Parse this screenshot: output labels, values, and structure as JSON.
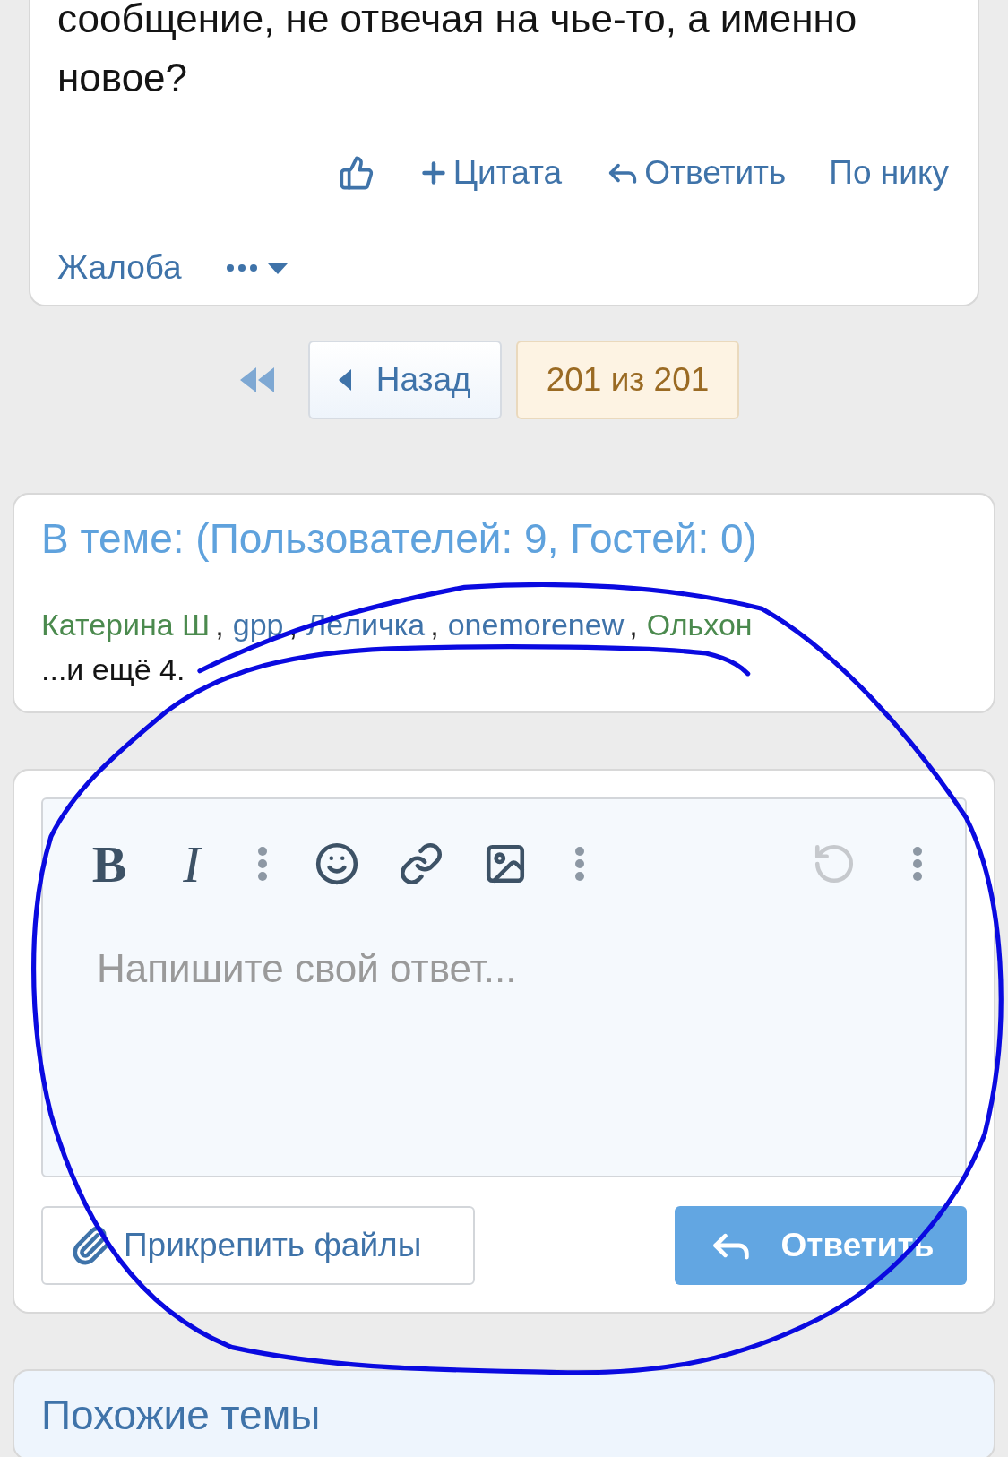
{
  "post": {
    "text": "сообщение, не отвечая на чье-то, а именно новое?",
    "actions_row_1": [
      {
        "kind": "like"
      },
      {
        "kind": "quote",
        "label": "Цитата"
      },
      {
        "kind": "reply",
        "label": "Ответить"
      },
      {
        "kind": "plain",
        "label": "По нику"
      }
    ],
    "actions_row_2": [
      {
        "kind": "plain",
        "label": "Жалоба"
      },
      {
        "kind": "more"
      }
    ]
  },
  "pagination": {
    "previous": "Назад",
    "current": "201 из 201"
  },
  "online": {
    "title": "В теме: (Пользователей: 9, Гостей: 0)",
    "separator": ",",
    "users": [
      {
        "name": "Катерина Ш",
        "color": "#4b8a4e"
      },
      {
        "name": "gpp",
        "color": "#3f73a9"
      },
      {
        "name": "Лёличка",
        "color": "#3f73a9"
      },
      {
        "name": "onemorenew",
        "color": "#3f73a9"
      },
      {
        "name": "Ольхон",
        "color": "#4b8a4e"
      }
    ],
    "more": "...и ещё 4."
  },
  "editor": {
    "toolbar_left": [
      {
        "kind": "bold",
        "label": "B",
        "disabled": false
      },
      {
        "kind": "italic",
        "label": "I",
        "disabled": false
      },
      {
        "kind": "more",
        "disabled": false
      },
      {
        "kind": "emoji",
        "disabled": false
      },
      {
        "kind": "link",
        "disabled": false
      },
      {
        "kind": "image",
        "disabled": false
      },
      {
        "kind": "more",
        "disabled": false
      }
    ],
    "toolbar_right": [
      {
        "kind": "undo",
        "disabled": true
      },
      {
        "kind": "more",
        "disabled": false
      }
    ],
    "placeholder": "Напишите свой ответ...",
    "attach": "Прикрепить файлы",
    "submit": "Ответить"
  },
  "similar": {
    "title": "Похожие темы"
  }
}
